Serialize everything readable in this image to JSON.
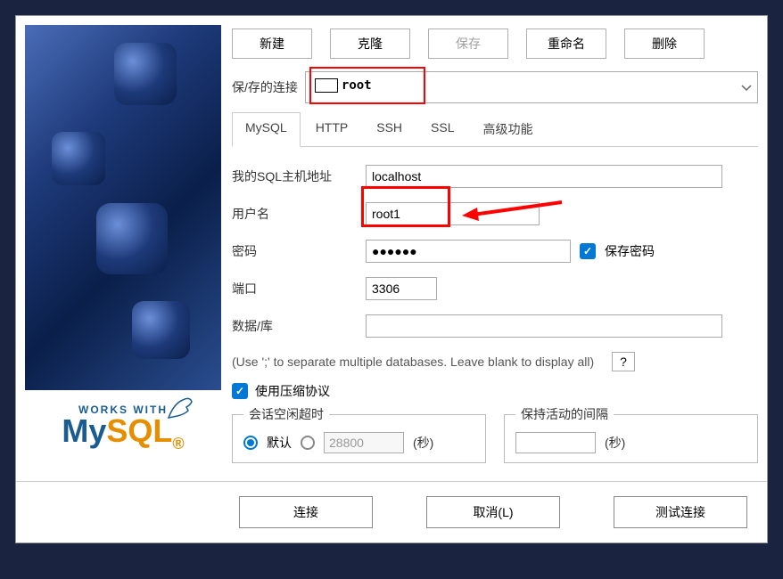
{
  "toolbar": {
    "new_btn": "新建",
    "clone_btn": "克隆",
    "save_btn": "保存",
    "rename_btn": "重命名",
    "delete_btn": "删除"
  },
  "saved_connection": {
    "label": "保/存的连接",
    "value": "root"
  },
  "tabs": {
    "mysql": "MySQL",
    "http": "HTTP",
    "ssh": "SSH",
    "ssl": "SSL",
    "advanced": "高级功能"
  },
  "form": {
    "host_label": "我的SQL主机地址",
    "host_value": "localhost",
    "username_label": "用户名",
    "username_value": "root1",
    "password_label": "密码",
    "password_value": "●●●●●●",
    "save_password_label": "保存密码",
    "port_label": "端口",
    "port_value": "3306",
    "database_label": "数据/库",
    "database_value": ""
  },
  "hint": {
    "text": "(Use ';' to separate multiple databases. Leave blank to display all)",
    "help": "?"
  },
  "compress": {
    "label": "使用压缩协议"
  },
  "timeout": {
    "legend": "会话空闲超时",
    "default_label": "默认",
    "custom_value": "28800",
    "unit": "(秒)"
  },
  "keepalive": {
    "legend": "保持活动的间隔",
    "value": "",
    "unit": "(秒)"
  },
  "bottom": {
    "connect": "连接",
    "cancel": "取消(L)",
    "test": "测试连接"
  },
  "logo": {
    "works_with": "WORKS WITH",
    "my": "My",
    "sql": "SQL"
  }
}
